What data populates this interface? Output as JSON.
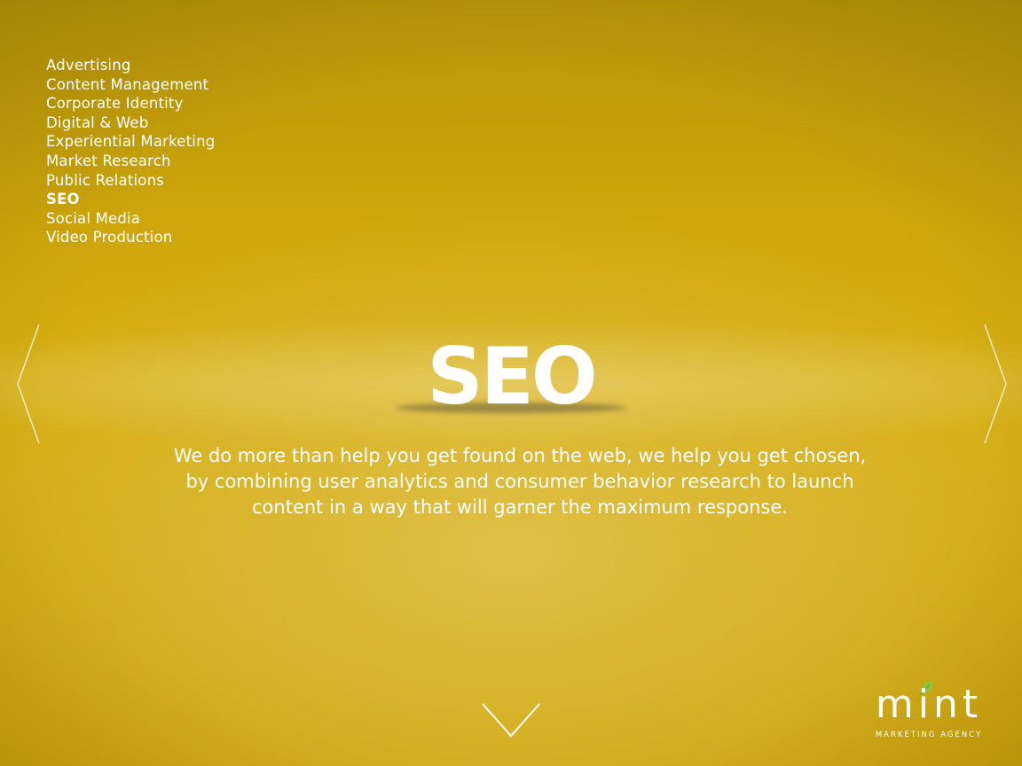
{
  "nav": {
    "items": [
      {
        "label": "Advertising",
        "active": false
      },
      {
        "label": "Content Management",
        "active": false
      },
      {
        "label": "Corporate Identity",
        "active": false
      },
      {
        "label": "Digital & Web",
        "active": false
      },
      {
        "label": "Experiential Marketing",
        "active": false
      },
      {
        "label": "Market Research",
        "active": false
      },
      {
        "label": "Public Relations",
        "active": false
      },
      {
        "label": "SEO",
        "active": true
      },
      {
        "label": "Social Media",
        "active": false
      },
      {
        "label": "Video Production",
        "active": false
      }
    ]
  },
  "main": {
    "title": "SEO",
    "description": "We do more than help you get found on the web, we help you get chosen, by combining user analytics and consumer behavior research to launch content in a way that will garner the maximum response."
  },
  "icons": {
    "prev": "chevron-left-icon",
    "next": "chevron-right-icon",
    "down": "chevron-down-icon",
    "leaf": "leaf-icon"
  },
  "brand": {
    "name": "mint",
    "tagline": "MARKETING AGENCY",
    "leaf_color": "#8cc63f"
  },
  "colors": {
    "background": "#d2aa10",
    "text": "#ffffff"
  }
}
